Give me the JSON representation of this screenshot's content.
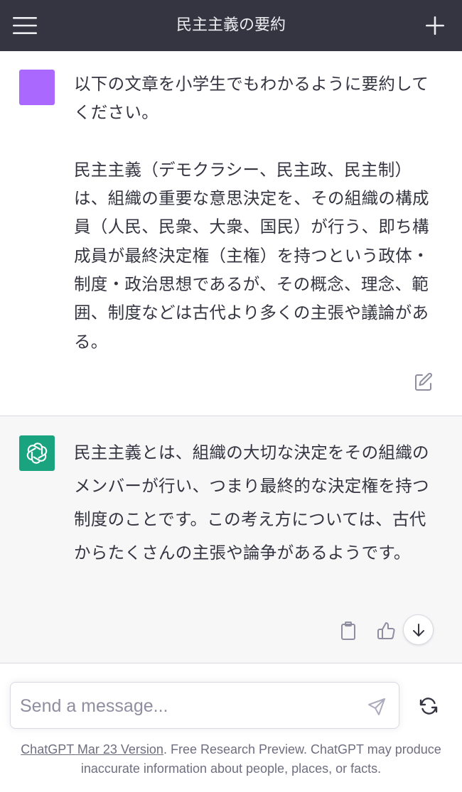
{
  "header": {
    "title": "民主主義の要約",
    "menu_icon": "hamburger-menu-icon",
    "new_chat_icon": "plus-icon"
  },
  "user_message": {
    "avatar_color": "#ab68ff",
    "text": "以下の文章を小学生でもわかるように要約してください。\n\n民主主義（デモクラシー、民主政、民主制）は、組織の重要な意思決定を、その組織の構成員（人民、民衆、大衆、国民）が行う、即ち構成員が最終決定権（主権）を持つという政体・制度・政治思想であるが、その概念、理念、範囲、制度などは古代より多くの主張や議論がある。",
    "edit_icon": "edit-icon"
  },
  "assistant_message": {
    "avatar_color": "#19a37f",
    "avatar_icon": "openai-logo-icon",
    "text": "民主主義とは、組織の大切な決定をその組織のメンバーが行い、つまり最終的な決定権を持つ制度のことです。この考え方については、古代からたくさんの主張や論争があるようです。",
    "actions": [
      "clipboard-icon",
      "thumbs-up-icon",
      "arrow-down-icon"
    ]
  },
  "composer": {
    "placeholder": "Send a message...",
    "send_icon": "send-icon",
    "regenerate_icon": "refresh-icon"
  },
  "footer": {
    "link_text": "ChatGPT Mar 23 Version",
    "text": ". Free Research Preview. ChatGPT may produce inaccurate information about people, places, or facts."
  }
}
